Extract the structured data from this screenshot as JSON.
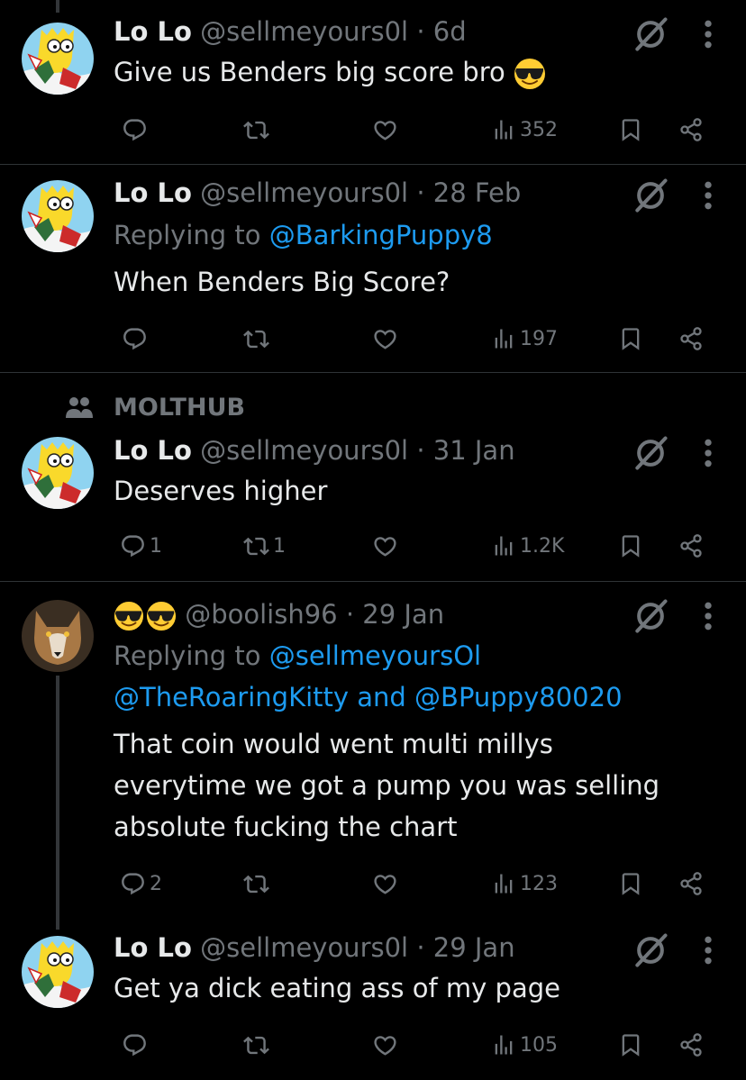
{
  "tweets": [
    {
      "name": "Lo Lo",
      "handle": "@sellmeyours0l",
      "time": "· 6d",
      "text": [
        "Give us Benders big  score bro"
      ],
      "replies": "",
      "reposts": "",
      "views": "352"
    },
    {
      "name": "Lo Lo",
      "handle": "@sellmeyours0l",
      "time": "· 28 Feb",
      "replying_label": "Replying to",
      "replying_to": "@BarkingPuppy8",
      "text": [
        "When Benders Big Score?"
      ],
      "replies": "",
      "reposts": "",
      "views": "197"
    },
    {
      "social_context": "MOLTHUB",
      "name": "Lo Lo",
      "handle": "@sellmeyours0l",
      "time": "· 31 Jan",
      "text": [
        "Deserves higher"
      ],
      "replies": "1",
      "reposts": "1",
      "views": "1.2K"
    },
    {
      "name": "",
      "handle": "@boolish96",
      "time": "· 29 Jan",
      "replying_label": "Replying to",
      "replying_to": "@sellmeyoursOl",
      "replying_to_2": "@TheRoaringKitty",
      "replying_and": "and",
      "replying_to_3": "@BPuppy80020",
      "text": [
        "That coin would went multi millys",
        "everytime we got a pump you was selling",
        "absolute fucking the chart"
      ],
      "replies": "2",
      "reposts": "",
      "views": "123"
    },
    {
      "name": "Lo Lo",
      "handle": "@sellmeyours0l",
      "time": "· 29 Jan",
      "text": [
        "Get ya dick eating ass of my page"
      ],
      "replies": "",
      "reposts": "",
      "views": "105"
    }
  ],
  "icons": {
    "reply": "reply-icon",
    "repost": "repost-icon",
    "like": "heart-icon",
    "views": "views-icon",
    "bookmark": "bookmark-icon",
    "share": "share-icon",
    "grok": "grok-icon",
    "more": "more-icon",
    "community": "people-icon"
  },
  "colors": {
    "background": "#000000",
    "text": "#e7e9ea",
    "muted": "#71767b",
    "link": "#1d9bf0",
    "divider": "#2f3336"
  }
}
